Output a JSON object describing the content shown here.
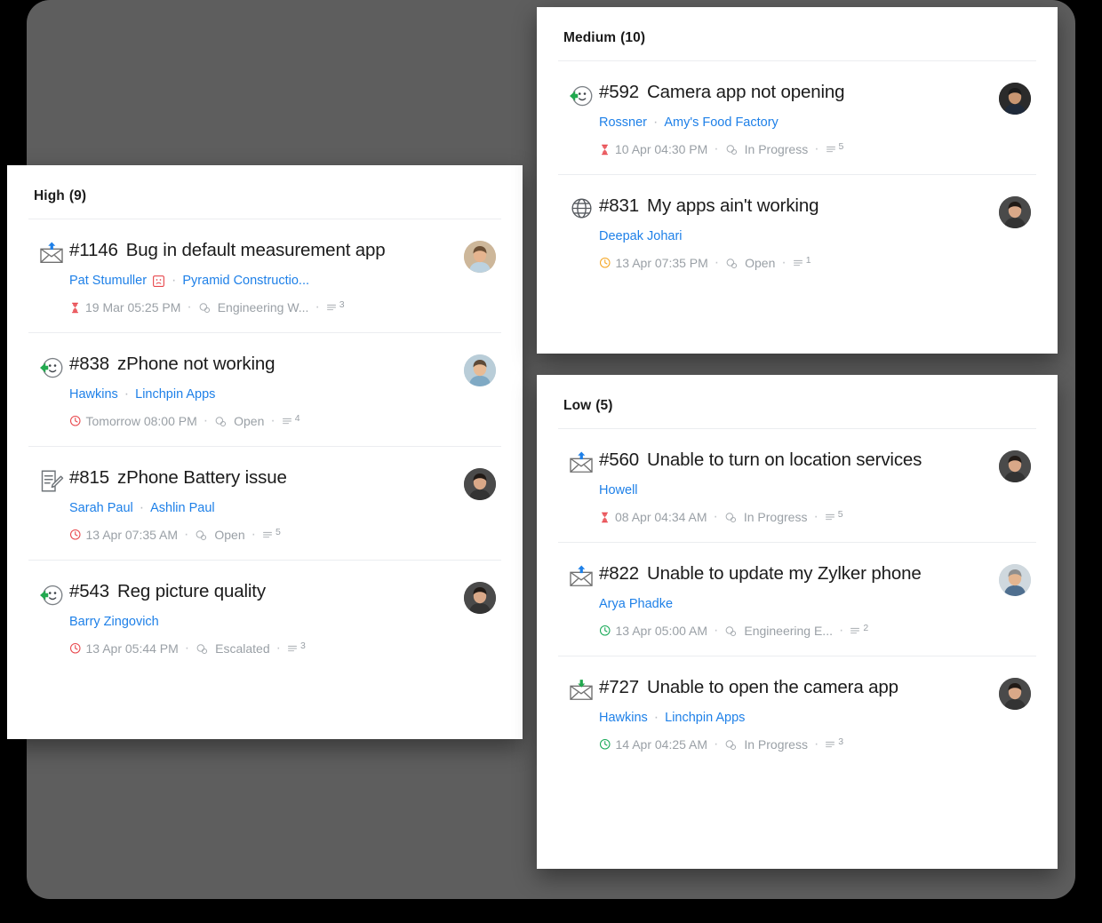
{
  "background": {
    "backdrop_color": "#5e5e5e",
    "page_color": "#000000"
  },
  "colors": {
    "link": "#1e80e8",
    "title": "#1b1b1b",
    "meta": "#9aa0a6",
    "overdue_red": "#e8474c",
    "due_soon_orange": "#f5a623",
    "on_time_green": "#18a957",
    "separator": "#ebedf0"
  },
  "panels": [
    {
      "id": "high",
      "title": "High",
      "count": "(9)",
      "tickets": [
        {
          "icon": "email-out-icon",
          "id": "#1146",
          "subject": "Bug in default measurement app",
          "contact": "Pat Stumuller",
          "mood": "sad-face-icon",
          "account": "Pyramid Constructio...",
          "due_icon": "hourglass-icon",
          "due_color": "#e8474c",
          "due": "19 Mar 05:25 PM",
          "status_icon": "status-bubble-icon",
          "status": "Engineering W...",
          "threads_icon": "threads-icon",
          "threads": "3",
          "avatar": "avatar-man-beige"
        },
        {
          "icon": "chat-in-icon",
          "id": "#838",
          "subject": "zPhone not working",
          "contact": "Hawkins",
          "mood": "",
          "account": "Linchpin Apps",
          "due_icon": "clock-icon",
          "due_color": "#e8474c",
          "due": "Tomorrow 08:00 PM",
          "status_icon": "status-bubble-icon",
          "status": "Open",
          "threads_icon": "threads-icon",
          "threads": "4",
          "avatar": "avatar-man-blue"
        },
        {
          "icon": "web-form-icon",
          "id": "#815",
          "subject": "zPhone Battery issue",
          "contact": "Sarah Paul",
          "mood": "",
          "account": "Ashlin Paul",
          "due_icon": "clock-icon",
          "due_color": "#e8474c",
          "due": "13 Apr 07:35 AM",
          "status_icon": "status-bubble-icon",
          "status": "Open",
          "threads_icon": "threads-icon",
          "threads": "5",
          "avatar": "avatar-woman-dark"
        },
        {
          "icon": "chat-in-icon",
          "id": "#543",
          "subject": "Reg picture quality",
          "contact": "Barry Zingovich",
          "mood": "",
          "account": "",
          "due_icon": "clock-icon",
          "due_color": "#e8474c",
          "due": "13 Apr 05:44 PM",
          "status_icon": "status-bubble-icon",
          "status": "Escalated",
          "threads_icon": "threads-icon",
          "threads": "3",
          "avatar": "avatar-woman-dark"
        }
      ]
    },
    {
      "id": "medium",
      "title": "Medium",
      "count": "(10)",
      "tickets": [
        {
          "icon": "chat-in-icon",
          "id": "#592",
          "subject": "Camera app not opening",
          "contact": "Rossner",
          "mood": "",
          "account": "Amy's Food Factory",
          "due_icon": "hourglass-icon",
          "due_color": "#e8474c",
          "due": "10 Apr 04:30 PM",
          "status_icon": "status-bubble-icon",
          "status": "In Progress",
          "threads_icon": "threads-icon",
          "threads": "5",
          "avatar": "avatar-man-suit"
        },
        {
          "icon": "globe-icon",
          "id": "#831",
          "subject": "My apps ain't working",
          "contact": "Deepak Johari",
          "mood": "",
          "account": "",
          "due_icon": "clock-icon",
          "due_color": "#f5a623",
          "due": "13 Apr 07:35 PM",
          "status_icon": "status-bubble-icon",
          "status": "Open",
          "threads_icon": "threads-icon",
          "threads": "1",
          "avatar": "avatar-woman-dark"
        }
      ]
    },
    {
      "id": "low",
      "title": "Low",
      "count": "(5)",
      "tickets": [
        {
          "icon": "email-out-icon",
          "id": "#560",
          "subject": "Unable to turn on location services",
          "contact": "Howell",
          "mood": "",
          "account": "",
          "due_icon": "hourglass-icon",
          "due_color": "#e8474c",
          "due": "08 Apr 04:34 AM",
          "status_icon": "status-bubble-icon",
          "status": "In Progress",
          "threads_icon": "threads-icon",
          "threads": "5",
          "avatar": "avatar-woman-dark"
        },
        {
          "icon": "email-out-icon",
          "id": "#822",
          "subject": "Unable to update my Zylker phone",
          "contact": "Arya Phadke",
          "mood": "",
          "account": "",
          "due_icon": "clock-icon",
          "due_color": "#18a957",
          "due": "13 Apr 05:00 AM",
          "status_icon": "status-bubble-icon",
          "status": "Engineering E...",
          "threads_icon": "threads-icon",
          "threads": "2",
          "avatar": "avatar-man-older"
        },
        {
          "icon": "email-in-icon",
          "id": "#727",
          "subject": "Unable to open the camera app",
          "contact": "Hawkins",
          "mood": "",
          "account": "Linchpin Apps",
          "due_icon": "clock-icon",
          "due_color": "#18a957",
          "due": "14 Apr 04:25 AM",
          "status_icon": "status-bubble-icon",
          "status": "In Progress",
          "threads_icon": "threads-icon",
          "threads": "3",
          "avatar": "avatar-woman-dark"
        }
      ]
    }
  ]
}
